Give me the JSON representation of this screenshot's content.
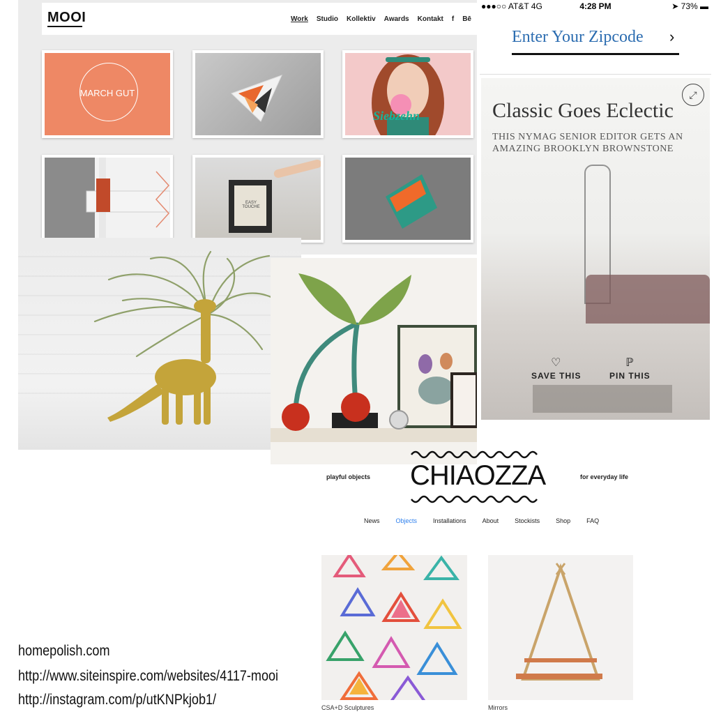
{
  "mooi": {
    "logo": "MOOI",
    "nav": [
      "Work",
      "Studio",
      "Kollektiv",
      "Awards",
      "Kontakt",
      "f",
      "Bē"
    ],
    "tile1_text": "MARCH GUT",
    "tile3_text": "Siebzehn",
    "tile5_text": "EASY TOUCHE",
    "colors": {
      "accent": "#ee8865",
      "background": "#ececec"
    }
  },
  "homepolish": {
    "status": {
      "carrier": "●●●○○ AT&T  4G",
      "time": "4:28 PM",
      "battery": "➤ 73% ▬"
    },
    "zip_prompt": "Enter Your Zipcode",
    "zip_arrow": "›",
    "card_title": "Classic Goes Eclectic",
    "card_subtitle": "THIS NYMAG SENIOR EDITOR GETS AN AMAZING BROOKLYN BROWNSTONE",
    "save_label": "SAVE THIS",
    "pin_label": "PIN THIS",
    "icons": {
      "expand": "expand-icon",
      "save": "heart-icon",
      "pin": "pinterest-icon"
    },
    "colors": {
      "zip_blue": "#2b6cb0"
    }
  },
  "chiaozza": {
    "tagline_left": "playful objects",
    "logo": "CHIAOZZA",
    "tagline_right": "for everyday life",
    "nav": [
      "News",
      "Objects",
      "Installations",
      "About",
      "Stockists",
      "Shop",
      "FAQ"
    ],
    "active_nav": "Objects",
    "items": [
      {
        "caption": "CSA+D Sculptures"
      },
      {
        "caption": "Mirrors"
      }
    ],
    "colors": {
      "active_link": "#2f80ed"
    }
  },
  "links": [
    "homepolish.com",
    "http://www.siteinspire.com/websites/4117-mooi",
    "http://instagram.com/p/utKNPkjob1/"
  ]
}
